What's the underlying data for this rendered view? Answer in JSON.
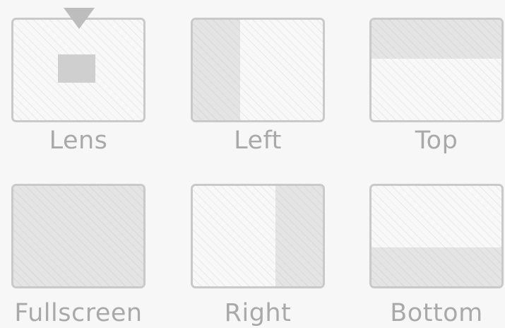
{
  "options": [
    {
      "label": "Lens"
    },
    {
      "label": "Left"
    },
    {
      "label": "Top"
    },
    {
      "label": "Fullscreen"
    },
    {
      "label": "Right"
    },
    {
      "label": "Bottom"
    }
  ],
  "colors": {
    "background": "#f7f7f7",
    "frame_border": "#c9c9c9",
    "panel_fill": "#e4e4e4",
    "label_text": "#a9a9a9"
  }
}
